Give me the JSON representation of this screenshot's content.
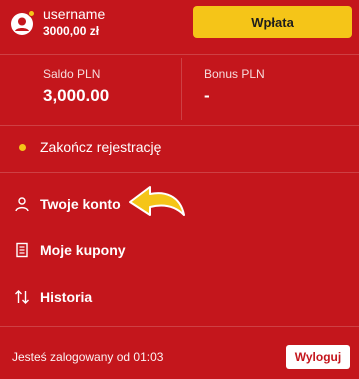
{
  "header": {
    "username": "username",
    "balance": "3000,00 zł",
    "deposit_label": "Wpłata"
  },
  "stats": {
    "saldo_label": "Saldo PLN",
    "saldo_value": "3,000.00",
    "bonus_label": "Bonus PLN",
    "bonus_value": "-"
  },
  "menu": {
    "items": [
      {
        "label": "Zakończ rejestrację",
        "icon": "status-dot-icon"
      },
      {
        "label": "Twoje konto",
        "icon": "user-icon"
      },
      {
        "label": "Moje kupony",
        "icon": "receipt-icon"
      },
      {
        "label": "Historia",
        "icon": "sort-arrows-icon"
      }
    ]
  },
  "footer": {
    "session_text": "Jesteś zalogowany od 01:03",
    "logout_label": "Wyloguj"
  },
  "colors": {
    "background": "#c4161c",
    "accent": "#f5c518",
    "text": "#ffffff"
  }
}
